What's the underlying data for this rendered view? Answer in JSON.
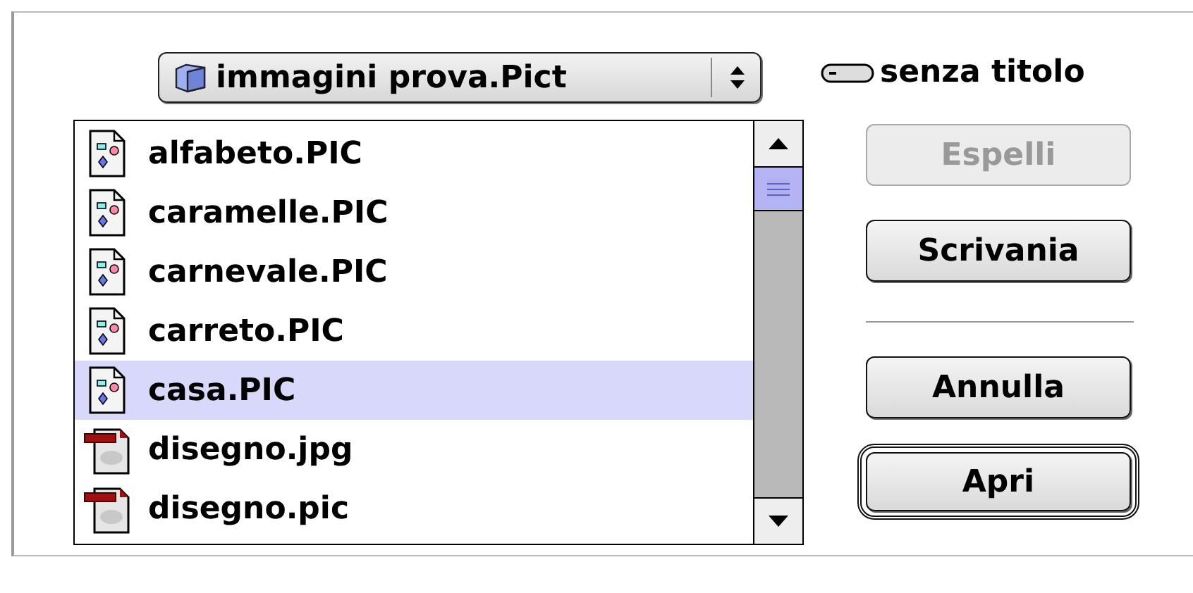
{
  "location_popup": {
    "label": "immagini prova.Pict"
  },
  "files": [
    {
      "name": "alfabeto.PIC",
      "kind": "pict",
      "selected": false
    },
    {
      "name": "caramelle.PIC",
      "kind": "pict",
      "selected": false
    },
    {
      "name": "carnevale.PIC",
      "kind": "pict",
      "selected": false
    },
    {
      "name": "carreto.PIC",
      "kind": "pict",
      "selected": false
    },
    {
      "name": "casa.PIC",
      "kind": "pict",
      "selected": true
    },
    {
      "name": "disegno.jpg",
      "kind": "jpeg",
      "selected": false
    },
    {
      "name": "disegno.pic",
      "kind": "jpeg",
      "selected": false
    }
  ],
  "disk": {
    "label": "senza titolo"
  },
  "button_groups": [
    [
      {
        "label": "Espelli",
        "disabled": true,
        "default": false
      },
      {
        "label": "Scrivania",
        "disabled": false,
        "default": false
      }
    ],
    [
      {
        "label": "Annulla",
        "disabled": false,
        "default": false
      },
      {
        "label": "Apri",
        "disabled": false,
        "default": true
      }
    ]
  ]
}
